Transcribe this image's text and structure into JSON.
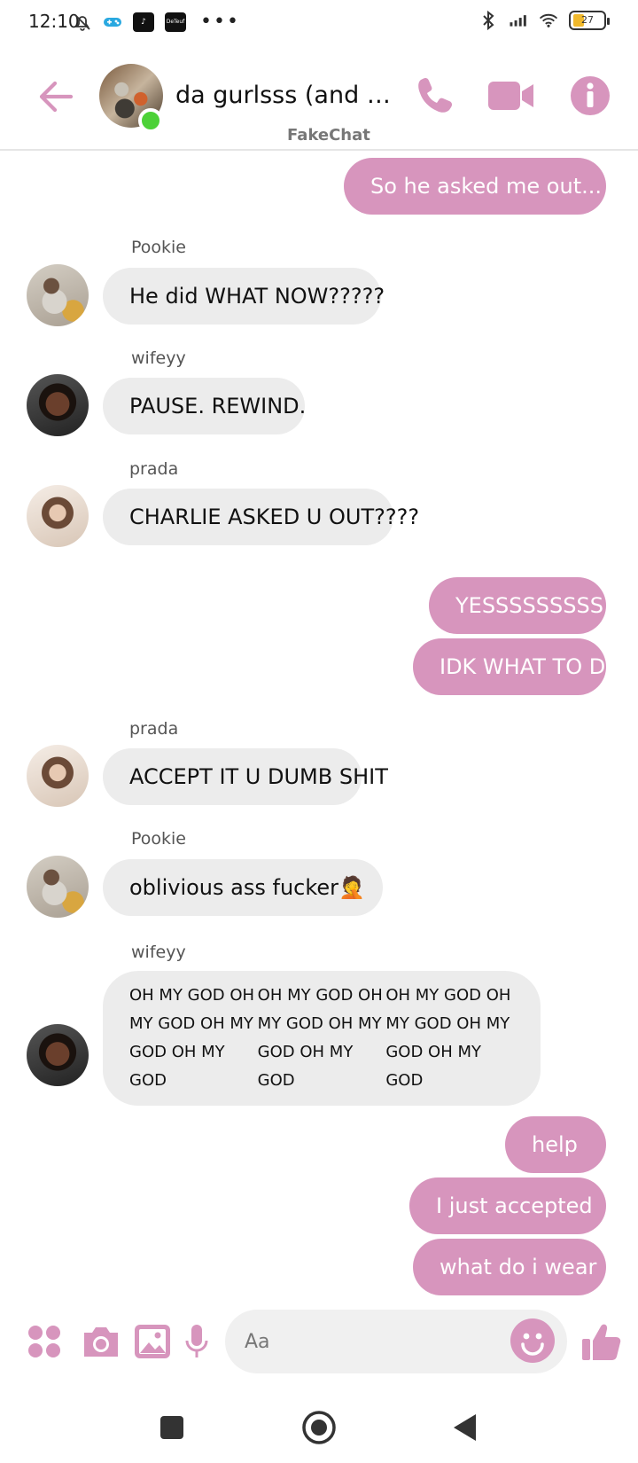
{
  "status_bar": {
    "time": "12:10",
    "tiktok_label": "♪",
    "app_label": "DeTeuf",
    "more": "•••",
    "battery": "27"
  },
  "header": {
    "title": "da gurlsss (and ary...",
    "app_name": "FakeChat",
    "accent_color": "#d795bd"
  },
  "messages": {
    "m1": "So he asked me out...",
    "s_pookie_1": "Pookie",
    "m2": "He did WHAT NOW?????",
    "s_wifeyy_1": "wifeyy",
    "m3": "PAUSE.  REWIND.",
    "s_prada_1": "prada",
    "m4": "CHARLIE ASKED U OUT????",
    "m5": "YESSSSSSSSS",
    "m6": "IDK WHAT TO DO",
    "s_prada_2": "prada",
    "m7": "ACCEPT IT U DUMB SHIT",
    "s_pookie_2": "Pookie",
    "m8": "oblivious ass fucker🤦",
    "s_wifeyy_2": "wifeyy",
    "m9_lines": [
      "OH MY GOD OH MY GOD OH MY GOD OH MY GOD",
      "OH MY GOD OH MY GOD OH MY GOD OH MY GOD",
      "OH MY GOD OH MY GOD OH MY GOD OH MY GOD"
    ],
    "m10": "help",
    "m11": "I just accepted",
    "m12": "what do i wear"
  },
  "composer": {
    "placeholder": "Aa"
  }
}
